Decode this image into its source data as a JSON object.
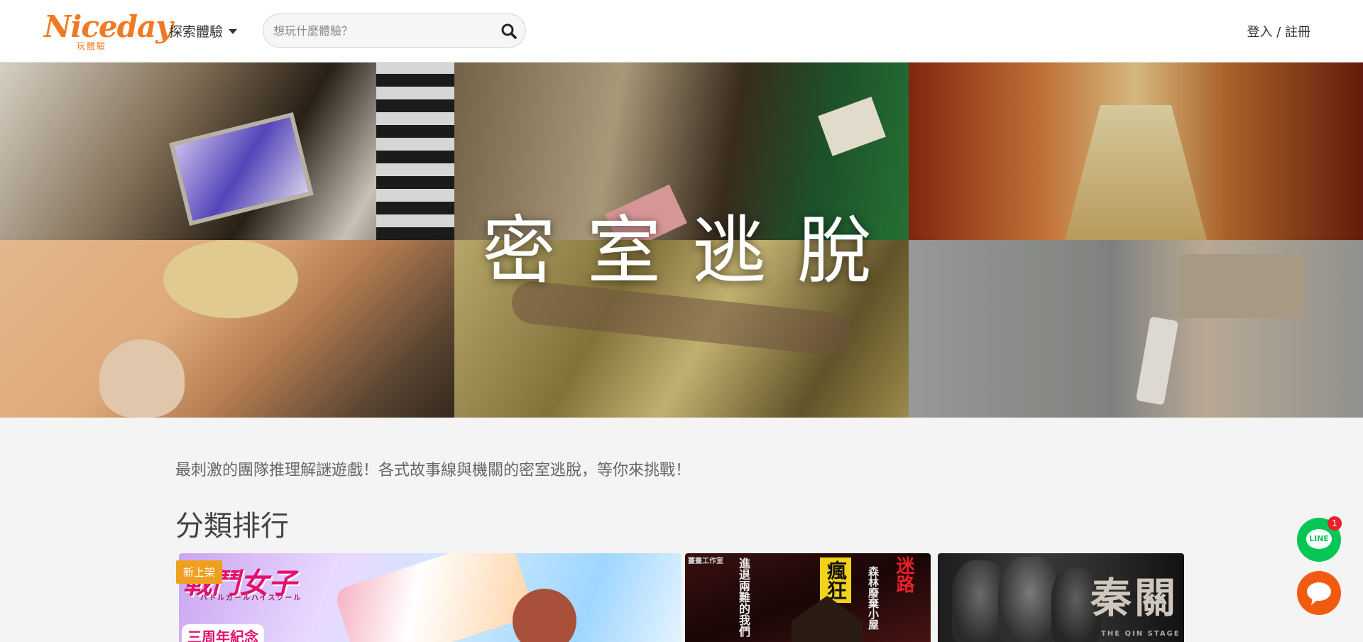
{
  "header": {
    "logo_text": "Niceday",
    "logo_subtext": "玩體驗",
    "explore_label": "探索體驗",
    "search_placeholder": "想玩什麼體驗？",
    "login_label": "登入",
    "separator": "/",
    "register_label": "註冊"
  },
  "hero": {
    "title": "密室逃脫"
  },
  "main": {
    "description": "最刺激的團隊推理解謎遊戲！各式故事線與機關的密室逃脫，等你來挑戰！",
    "section_title": "分類排行",
    "cards": [
      {
        "badge": "新上架",
        "logo_text": "戰鬥女子",
        "logo_sub": "バトルガールハイスクール",
        "banner": "三周年紀念"
      },
      {
        "corner": "薑畫工作室",
        "col_a": "進退兩難的我們",
        "col_b": "瘋狂",
        "col_c": "迷路",
        "col_d": "森林廢棄小屋"
      },
      {
        "title": "秦關",
        "subtitle": "THE QIN STAGE"
      }
    ]
  },
  "floating": {
    "line_label": "LINE",
    "line_badge": "1"
  }
}
